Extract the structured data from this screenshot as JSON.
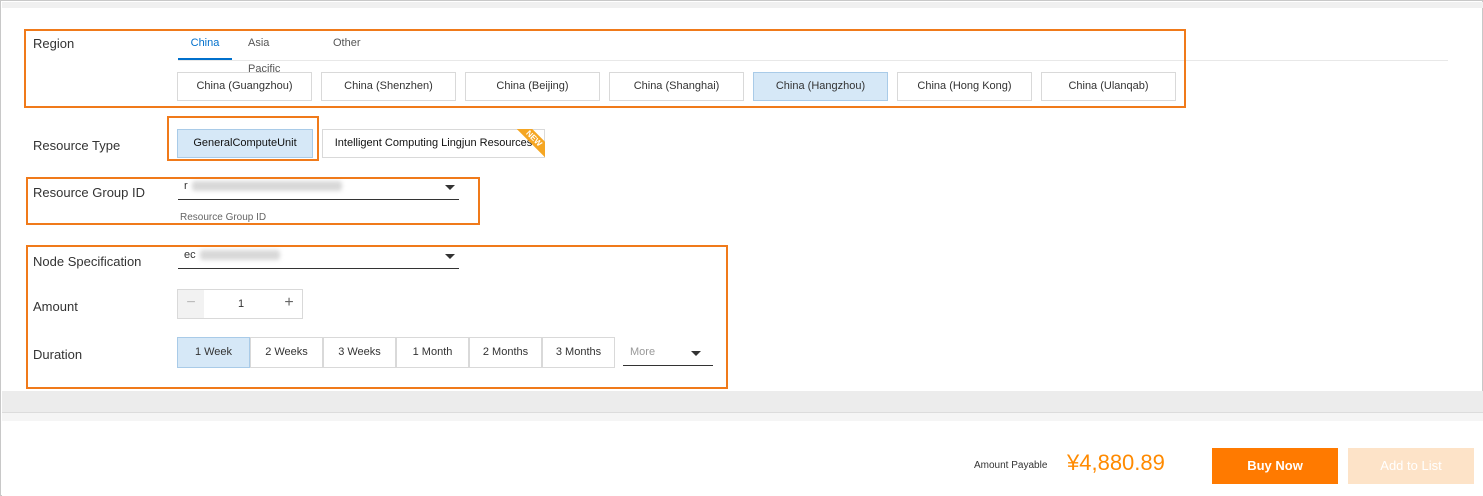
{
  "region": {
    "label": "Region",
    "tabs": [
      {
        "label": "China",
        "active": true
      },
      {
        "label": "Asia Pacific",
        "active": false
      },
      {
        "label": "Other",
        "active": false
      }
    ],
    "options": [
      {
        "label": "China (Guangzhou)",
        "selected": false
      },
      {
        "label": "China (Shenzhen)",
        "selected": false
      },
      {
        "label": "China (Beijing)",
        "selected": false
      },
      {
        "label": "China (Shanghai)",
        "selected": false
      },
      {
        "label": "China (Hangzhou)",
        "selected": true
      },
      {
        "label": "China (Hong Kong)",
        "selected": false
      },
      {
        "label": "China (Ulanqab)",
        "selected": false
      }
    ]
  },
  "resource_type": {
    "label": "Resource Type",
    "options": [
      {
        "label": "GeneralComputeUnit",
        "selected": true
      },
      {
        "label": "Intelligent Computing Lingjun Resources",
        "selected": false,
        "badge": "NEW"
      }
    ]
  },
  "resource_group": {
    "label": "Resource Group ID",
    "value_prefix": "r",
    "hint": "Resource Group ID"
  },
  "node_spec": {
    "label": "Node Specification",
    "value_prefix": "ec"
  },
  "amount": {
    "label": "Amount",
    "minus": "−",
    "value": "1",
    "plus": "+"
  },
  "duration": {
    "label": "Duration",
    "options": [
      {
        "label": "1 Week",
        "selected": true
      },
      {
        "label": "2 Weeks",
        "selected": false
      },
      {
        "label": "3 Weeks",
        "selected": false
      },
      {
        "label": "1 Month",
        "selected": false
      },
      {
        "label": "2 Months",
        "selected": false
      },
      {
        "label": "3 Months",
        "selected": false
      }
    ],
    "more": "More"
  },
  "footer": {
    "amount_label": "Amount Payable",
    "price": "¥4,880.89",
    "buy_label": "Buy Now",
    "add_label": "Add to List"
  },
  "colors": {
    "accent": "#0070cc",
    "highlight": "#f07a1a",
    "buy": "#ff7a00",
    "selected_bg": "#d6e8f7"
  }
}
